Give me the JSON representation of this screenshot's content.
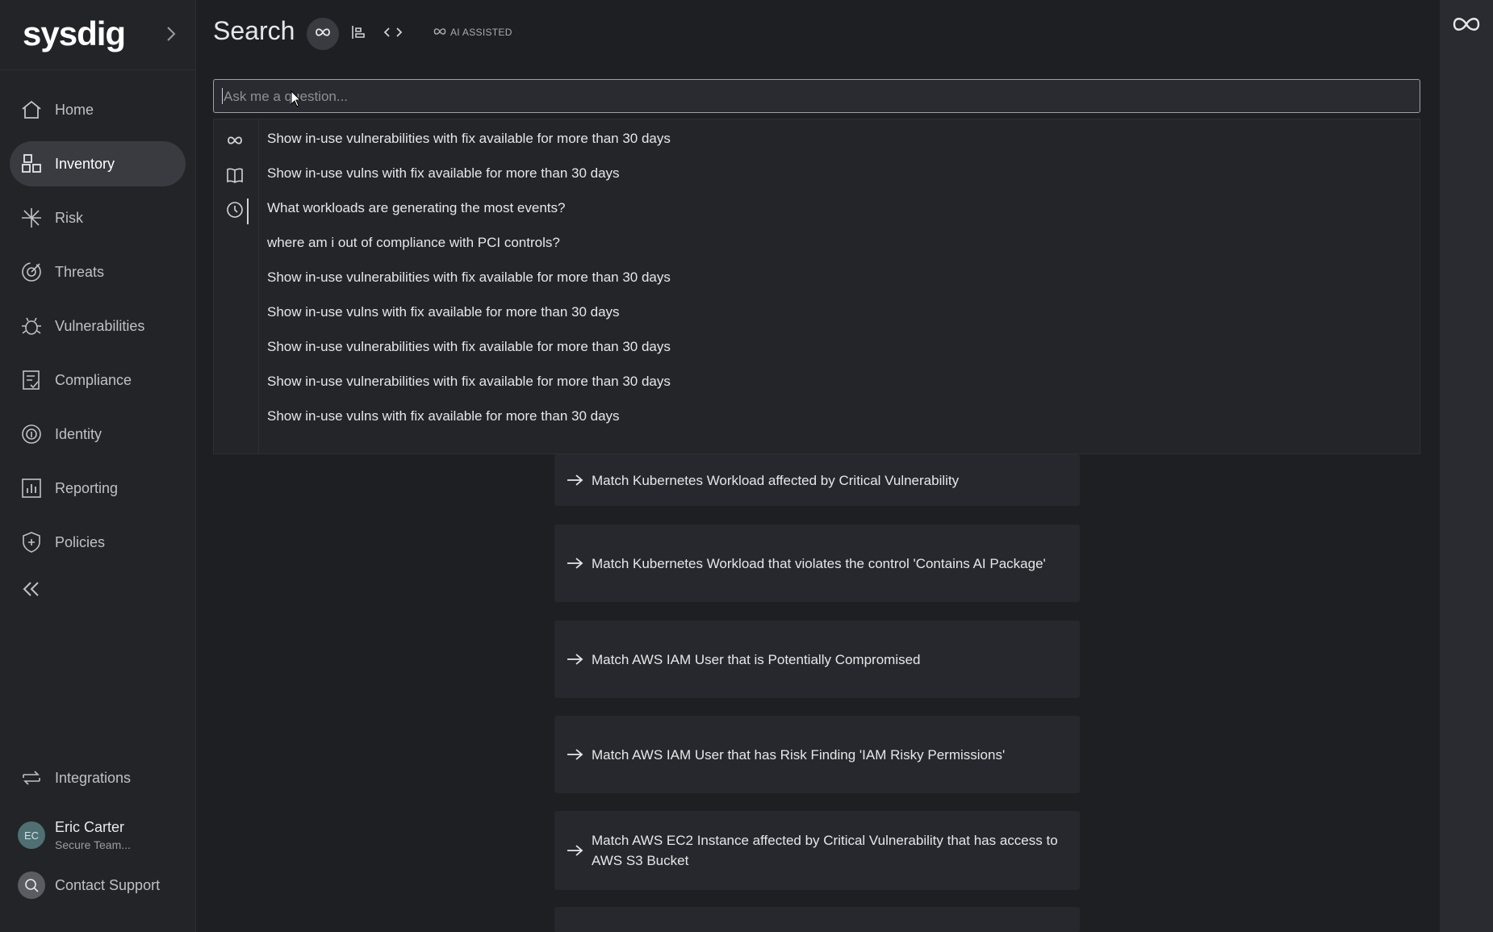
{
  "app": {
    "logo": "sysdig",
    "expand_icon": "chevron-right-icon"
  },
  "sidebar": {
    "items": [
      {
        "label": "Home",
        "icon": "home-icon"
      },
      {
        "label": "Inventory",
        "icon": "inventory-icon",
        "active": true
      },
      {
        "label": "Risk",
        "icon": "risk-icon"
      },
      {
        "label": "Threats",
        "icon": "threats-icon"
      },
      {
        "label": "Vulnerabilities",
        "icon": "bug-icon"
      },
      {
        "label": "Compliance",
        "icon": "compliance-icon"
      },
      {
        "label": "Identity",
        "icon": "fingerprint-icon"
      },
      {
        "label": "Reporting",
        "icon": "reporting-icon"
      },
      {
        "label": "Policies",
        "icon": "shield-icon"
      }
    ],
    "collapse_icon": "double-chevron-left-icon",
    "integrations": {
      "label": "Integrations",
      "icon": "integrations-icon"
    },
    "user": {
      "initials": "EC",
      "name": "Eric Carter",
      "team": "Secure Team..."
    },
    "support": {
      "label": "Contact Support",
      "icon": "support-icon"
    }
  },
  "header": {
    "title": "Search",
    "ai_tag": "AI ASSISTED",
    "mode_buttons": [
      "infinity-icon",
      "align-left-icon",
      "code-icon"
    ]
  },
  "search": {
    "placeholder": "Ask me a question..."
  },
  "dropdown": {
    "rail_icons": [
      "infinity-icon",
      "book-icon",
      "clock-icon"
    ],
    "suggestions": [
      "Show in-use vulnerabilities with fix available for more than 30 days",
      "Show in-use vulns with fix available for more than 30 days",
      "What workloads are generating the most events?",
      "where am i out of compliance with PCI controls?",
      "Show in-use vulnerabilities with fix available for more than 30 days",
      "Show in-use vulns with fix available for more than 30 days",
      "Show in-use vulnerabilities with fix available for more than 30 days",
      "Show in-use vulnerabilities with fix available for more than 30 days",
      "Show in-use vulns with fix available for more than 30 days"
    ]
  },
  "cards": [
    "Match Kubernetes Workload affected by Critical Vulnerability",
    "Match Kubernetes Workload that violates the control 'Contains AI Package'",
    "Match AWS IAM User that is Potentially Compromised",
    "Match AWS IAM User that has Risk Finding 'IAM Risky Permissions'",
    "Match AWS EC2 Instance affected by Critical Vulnerability that has access to AWS S3 Bucket"
  ],
  "right_panel": {
    "icon": "infinity-icon"
  },
  "colors": {
    "background": "#1e1f23",
    "sidebar": "#232428",
    "active_item": "#3a3b41",
    "card": "#27282d"
  }
}
